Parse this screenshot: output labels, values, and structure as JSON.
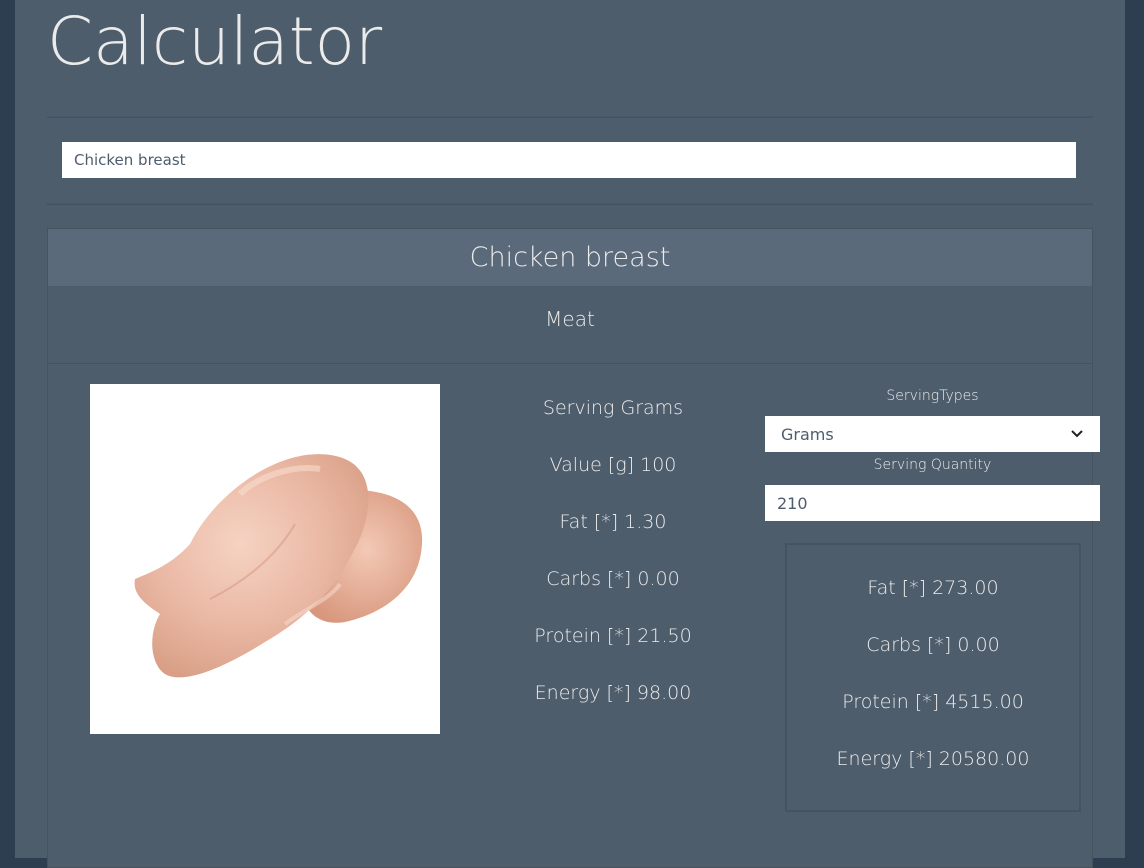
{
  "page": {
    "title": "Calculator"
  },
  "search": {
    "value": "Chicken breast"
  },
  "food": {
    "name": "Chicken breast",
    "category": "Meat",
    "image_icon": "chicken-breast-image"
  },
  "nutrients": {
    "serving": "Serving Grams",
    "value": "Value [g] 100",
    "fat": "Fat [*] 1.30",
    "carbs": "Carbs [*] 0.00",
    "protein": "Protein [*] 21.50",
    "energy": "Energy [*] 98.00"
  },
  "controls": {
    "serving_types_label": "ServingTypes",
    "serving_type_selected": "Grams",
    "serving_quantity_label": "Serving Quantity",
    "serving_quantity_value": "210"
  },
  "results": {
    "fat": "Fat [*] 273.00",
    "carbs": "Carbs [*] 0.00",
    "protein": "Protein [*] 4515.00",
    "energy": "Energy [*] 20580.00"
  },
  "colors": {
    "background": "#2c3e50",
    "panel": "#4e5d6c",
    "header": "#5a6a7a",
    "text": "#ebebeb"
  }
}
